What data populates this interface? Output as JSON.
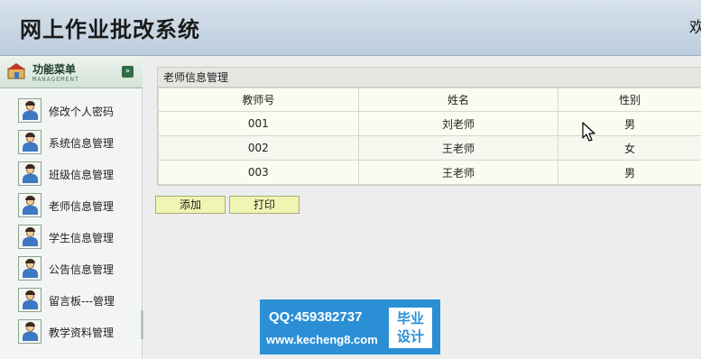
{
  "header": {
    "title": "网上作业批改系统",
    "welcome": "欢"
  },
  "sidebar": {
    "title": "功能菜单",
    "subtitle": "MANAGEMENT",
    "collapse_icon": "double-chevron-down-icon",
    "items": [
      {
        "label": "修改个人密码",
        "icon": "user-icon"
      },
      {
        "label": "系统信息管理",
        "icon": "user-icon"
      },
      {
        "label": "班级信息管理",
        "icon": "user-icon"
      },
      {
        "label": "老师信息管理",
        "icon": "user-icon"
      },
      {
        "label": "学生信息管理",
        "icon": "user-icon"
      },
      {
        "label": "公告信息管理",
        "icon": "user-icon"
      },
      {
        "label": "留言板---管理",
        "icon": "user-icon"
      },
      {
        "label": "教学资料管理",
        "icon": "user-icon"
      }
    ]
  },
  "main": {
    "panel_title": "老师信息管理",
    "columns": [
      "教师号",
      "姓名",
      "性别"
    ],
    "rows": [
      [
        "001",
        "刘老师",
        "男"
      ],
      [
        "002",
        "王老师",
        "女"
      ],
      [
        "003",
        "王老师",
        "男"
      ]
    ],
    "add_label": "添加",
    "print_label": "打印"
  },
  "watermark": {
    "qq": "QQ:459382737",
    "site": "www.kecheng8.com",
    "badge_line1": "毕业",
    "badge_line2": "设计"
  },
  "colors": {
    "header_bg": "#c8d7e5",
    "button_bg": "#f1f5b4",
    "watermark_bg": "#2b8fd6"
  }
}
